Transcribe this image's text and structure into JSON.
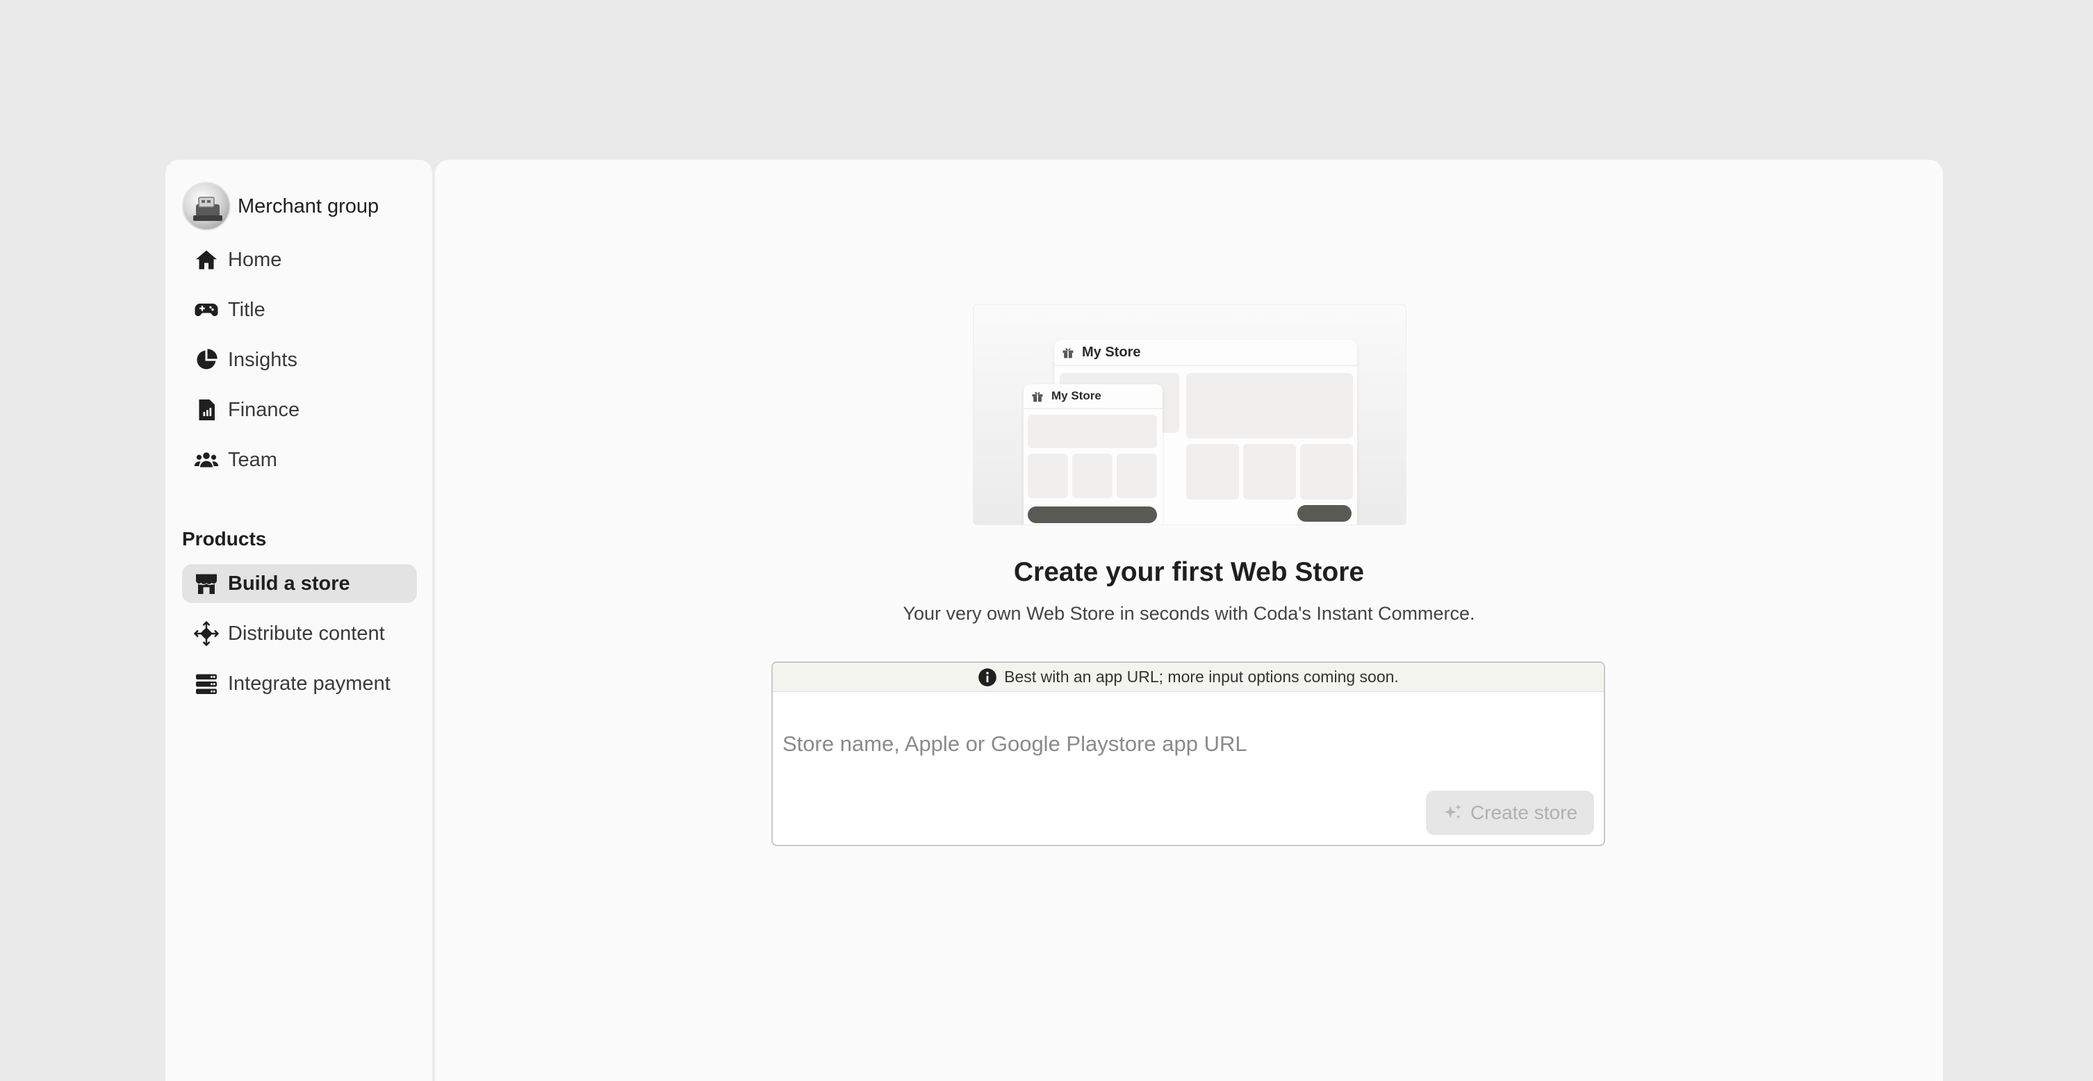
{
  "sidebar": {
    "merchant_name": "Merchant group",
    "nav": [
      {
        "label": "Home",
        "icon": "home-icon"
      },
      {
        "label": "Title",
        "icon": "gamepad-icon"
      },
      {
        "label": "Insights",
        "icon": "pie-chart-icon"
      },
      {
        "label": "Finance",
        "icon": "finance-doc-icon"
      },
      {
        "label": "Team",
        "icon": "team-icon"
      }
    ],
    "products_label": "Products",
    "products": [
      {
        "label": "Build a store",
        "icon": "store-icon",
        "active": true
      },
      {
        "label": "Distribute content",
        "icon": "distribute-arrows-icon",
        "active": false
      },
      {
        "label": "Integrate payment",
        "icon": "server-stack-icon",
        "active": false
      }
    ]
  },
  "main": {
    "illustration": {
      "desktop_title": "My Store",
      "mobile_title": "My Store"
    },
    "heading": "Create your first Web Store",
    "subheading": "Your very own Web Store in seconds with Coda's Instant Commerce.",
    "hint": "Best with an app URL; more input options coming soon.",
    "input_placeholder": "Store name, Apple or Google Playstore app URL",
    "input_value": "",
    "create_button": "Create store"
  },
  "colors": {
    "page_bg": "#eaeaea",
    "panel_bg": "#fbfbfb",
    "active_nav_bg": "#e3e3e3",
    "hint_bg": "#f4f4ef",
    "disabled_button_bg": "#e6e6e6",
    "pill_dark": "#5a5a55"
  }
}
